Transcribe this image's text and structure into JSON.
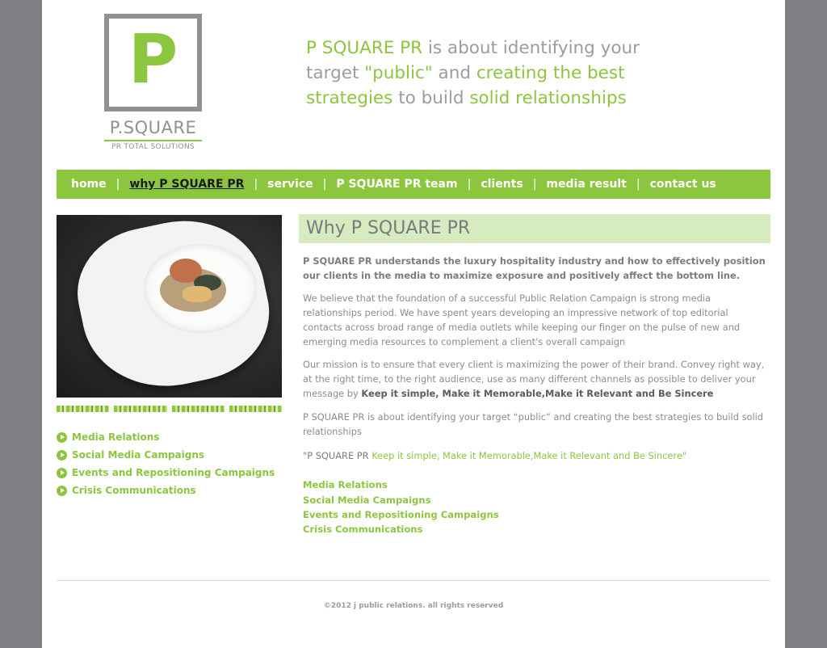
{
  "brand": {
    "logo_letter": "P",
    "name": "P.SQUARE",
    "subtitle": "PR TOTAL SOLUTIONS",
    "green": "#8cc63f",
    "gray": "#8f9194"
  },
  "tagline": {
    "part1": "P SQUARE PR",
    "part2": " is about identifying your target ",
    "part3": "\"public\"",
    "part4": " and ",
    "part5": "creating the best strategies",
    "part6": " to build ",
    "part7": "solid relationships"
  },
  "nav": {
    "items": [
      {
        "label": "home"
      },
      {
        "label": "why P SQUARE PR"
      },
      {
        "label": "service"
      },
      {
        "label": "P SQUARE PR team"
      },
      {
        "label": "clients"
      },
      {
        "label": "media result"
      },
      {
        "label": "contact us"
      }
    ],
    "separator": "|"
  },
  "sidebar": {
    "items": [
      {
        "label": "Media Relations"
      },
      {
        "label": "Social Media Campaigns"
      },
      {
        "label": "Events and Repositioning Campaigns"
      },
      {
        "label": "Crisis Communications"
      }
    ]
  },
  "main": {
    "heading": "Why P SQUARE PR",
    "lead": "P SQUARE PR understands the luxury hospitality industry and how to effectively position our clients in the media to maximize exposure and positively affect the bottom line.",
    "p2": "We believe that the foundation of a successful Public Relation Campaign is strong media relationships period. We have spent years developing an impressive network of top editorial contacts across broad range of media outlets while keeping our finger on the pulse of new and emerging media resources to complement a client's overall campaign",
    "p3_text": "Our mission is to ensure that every client is maximizing the power of their brand. Convey right way, at the right time, to the right audience, use as many different channels as possible to deliver your message by ",
    "p3_bold": "Keep it simple, Make it Memorable,Make it Relevant and Be Sincere",
    "p4": "P SQUARE PR is about identifying your target “public” and creating the best strategies to build solid relationships",
    "quote_prefix": "\"P SQUARE PR",
    "quote_text": " Keep it simple, Make it Memorable,Make it Relevant and Be Sincere\"",
    "services": [
      {
        "label": "Media Relations"
      },
      {
        "label": "Social Media Campaigns"
      },
      {
        "label": "Events and Repositioning Campaigns"
      },
      {
        "label": "Crisis Communications"
      }
    ]
  },
  "footer": {
    "copyright": "©2012 j public relations. all rights reserved"
  }
}
